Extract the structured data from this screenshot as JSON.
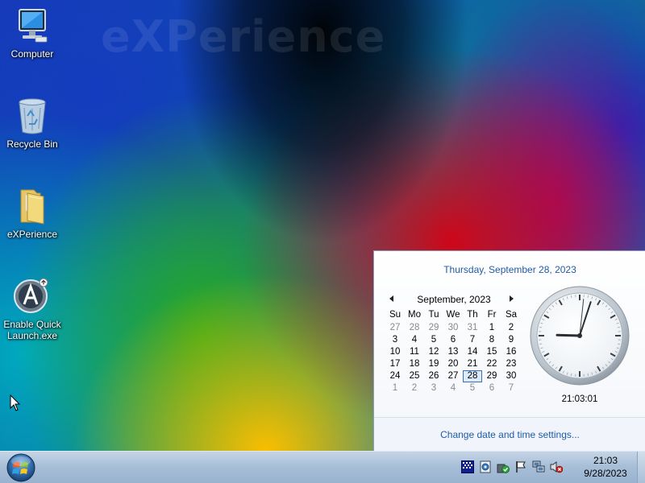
{
  "desktop": {
    "watermark": "eXPerience",
    "icons": [
      {
        "label": "Computer",
        "icon": "computer-icon"
      },
      {
        "label": "Recycle Bin",
        "icon": "recycle-bin-icon"
      },
      {
        "label": "eXPerience",
        "icon": "folder-icon"
      },
      {
        "label": "Enable Quick\nLaunch.exe",
        "icon": "app-exe-icon"
      }
    ]
  },
  "clock_popup": {
    "long_date": "Thursday, September 28, 2023",
    "calendar": {
      "month_title": "September, 2023",
      "weekdays": [
        "Su",
        "Mo",
        "Tu",
        "We",
        "Th",
        "Fr",
        "Sa"
      ],
      "weeks": [
        [
          "27",
          "28",
          "29",
          "30",
          "31",
          "1",
          "2"
        ],
        [
          "3",
          "4",
          "5",
          "6",
          "7",
          "8",
          "9"
        ],
        [
          "10",
          "11",
          "12",
          "13",
          "14",
          "15",
          "16"
        ],
        [
          "17",
          "18",
          "19",
          "20",
          "21",
          "22",
          "23"
        ],
        [
          "24",
          "25",
          "26",
          "27",
          "28",
          "29",
          "30"
        ],
        [
          "1",
          "2",
          "3",
          "4",
          "5",
          "6",
          "7"
        ]
      ],
      "today": "28"
    },
    "analog_time": {
      "hours": 21,
      "minutes": 3,
      "seconds": 1
    },
    "digital_time": "21:03:01",
    "settings_link": "Change date and time settings..."
  },
  "taskbar": {
    "start_icon": "windows-orb-icon",
    "tray_icons": [
      "display-icon",
      "network-tray-icon",
      "security-shield-icon",
      "flag-icon",
      "network-icon",
      "volume-muted-icon"
    ],
    "time": "21:03",
    "date": "9/28/2023"
  },
  "colors": {
    "link_blue": "#1e5ba6",
    "today_border": "#3a6fb9",
    "today_fill": "#dcebfc"
  }
}
